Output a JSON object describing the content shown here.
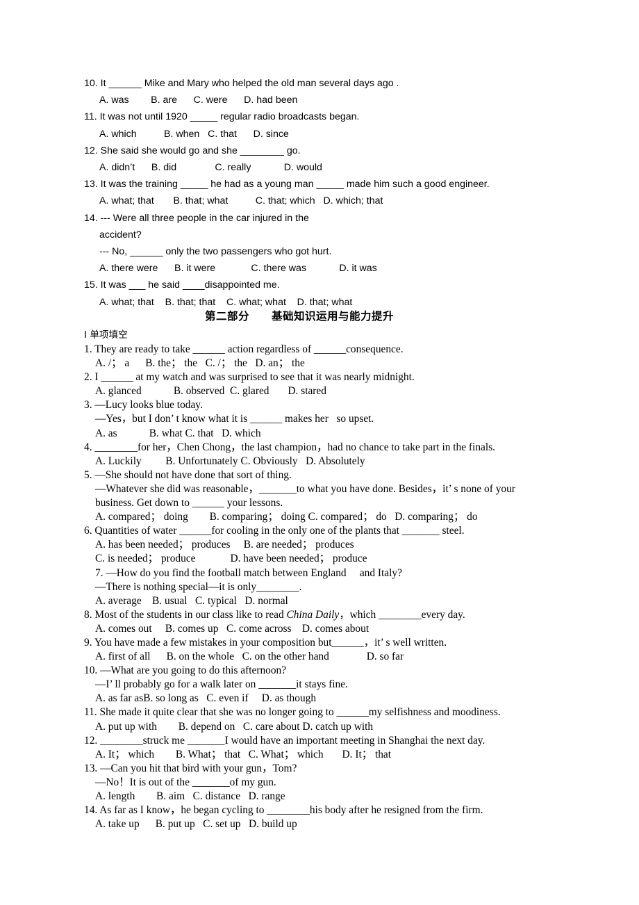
{
  "document": {
    "part1": {
      "font_style": "sans-serif",
      "questions": [
        {
          "id": "p1-q10",
          "stem": "10. It ______ Mike and Mary who helped the old man several days ago .",
          "options": "A. was        B. are      C. were      D. had been"
        },
        {
          "id": "p1-q11",
          "stem": "11. It was not until 1920 _____ regular radio broadcasts began.",
          "options": "A. which          B. when   C. that      D. since"
        },
        {
          "id": "p1-q12",
          "stem": "12. She said she would go and she ________ go.",
          "options": "A. didn’t      B. did              C. really            D. would"
        },
        {
          "id": "p1-q13",
          "stem": "13. It was the training _____ he had as a young man _____ made him such a good engineer.",
          "options": "A. what; that       B. that; what          C. that; which   D. which; that"
        },
        {
          "id": "p1-q14",
          "stem": "14. --- Were all three people in the car injured in the",
          "continuation1": "accident?",
          "continuation2": "--- No, ______ only the two passengers who got hurt.",
          "options": "A. there were      B. it were             C. there was            D. it was"
        },
        {
          "id": "p1-q15",
          "stem": "15. It was ___ he said ____disappointed me.",
          "options": "A. what; that    B. that; that    C. what; what    D. that; what"
        }
      ]
    },
    "section_heading": "第二部分　　基础知识运用与能力提升",
    "part2": {
      "font_style": "serif",
      "subsection_label": "Ⅰ 单项填空",
      "questions": [
        {
          "id": "p2-q1",
          "stem": "1. They are ready to take ______ action regardless of ______consequence.",
          "options": "A. /； a      B. the； the   C. /； the   D. an； the"
        },
        {
          "id": "p2-q2",
          "stem": "2. I ______ at my watch and was surprised to see that it was nearly midnight.",
          "options": "A. glanced            B. observed  C. glared       D. stared"
        },
        {
          "id": "p2-q3",
          "stem": "3. —Lucy looks blue today.",
          "continuation1": "—Yes，but I don’ t know what it is ______ makes her   so upset.",
          "options": "A. as            B. what C. that   D. which"
        },
        {
          "id": "p2-q4",
          "stem": "4. ________for her，Chen Chong，the last champion，had no chance to take part in the finals.",
          "options": "A. Luckily         B. Unfortunately C. Obviously   D. Absolutely"
        },
        {
          "id": "p2-q5",
          "stem": "5. —She should not have done that sort of thing.",
          "continuation1": "—Whatever she did was reasonable，_______to what you have done. Besides，it’ s none of your",
          "continuation2": "business. Get down to ______ your lessons.",
          "options": "A. compared； doing        B. comparing； doing C. compared； do   D. comparing； do"
        },
        {
          "id": "p2-q6",
          "stem": "6. Quantities of water ______for cooling in the only one of the plants that _______ steel.",
          "options_line1": "A. has been needed； produces     B. are needed； produces",
          "options_line2": "C. is needed； produce             D. have been needed； produce"
        },
        {
          "id": "p2-q7",
          "stem": "7. —How do you find the football match between England     and Italy?",
          "continuation1": "—There is nothing special—it is only________.",
          "options": "A. average    B. usual   C. typical   D. normal"
        },
        {
          "id": "p2-q8",
          "stem_pre": "8. Most of the students in our class like to read ",
          "stem_italic": "China Daily",
          "stem_post": "，which ________every day.",
          "options": "A. comes out     B. comes up   C. come across    D. comes about"
        },
        {
          "id": "p2-q9",
          "stem": "9. You have made a few mistakes in your composition but______，it’ s well written.",
          "options": "A. first of all      B. on the whole   C. on the other hand              D. so far"
        },
        {
          "id": "p2-q10",
          "stem": "10. —What are you going to do this afternoon?",
          "continuation1": "—I’ ll probably go for a walk later on _______it stays fine.",
          "options": "A. as far asB. so long as   C. even if     D. as though"
        },
        {
          "id": "p2-q11",
          "stem": "11. She made it quite clear that she was no longer going to ______my selfishness and moodiness.",
          "options": "A. put up with        B. depend on   C. care about D. catch up with"
        },
        {
          "id": "p2-q12",
          "stem": "12. ________struck me _______I would have an important meeting in Shanghai the next day.",
          "options": "A. It； which        B. What； that   C. What； which       D. It； that"
        },
        {
          "id": "p2-q13",
          "stem": "13. —Can you hit that bird with your gun，Tom?",
          "continuation1": "—No！It is out of the _______of my gun.",
          "options": "A. length        B. aim   C. distance   D. range"
        },
        {
          "id": "p2-q14",
          "stem": "14. As far as I know，he began cycling to ________his body after he resigned from the firm.",
          "options": "A. take up      B. put up   C. set up   D. build up"
        }
      ]
    }
  }
}
